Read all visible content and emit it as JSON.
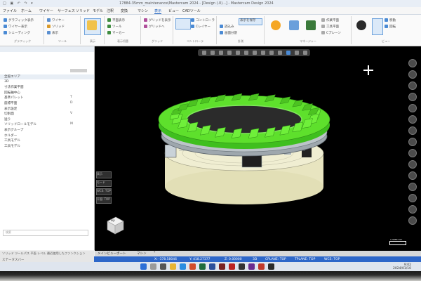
{
  "window": {
    "title": "17884-35mm_maintenance\\Mastercam 2024 - [Design (.0)...] - Mastercam Design 2024",
    "quick_access": "□ ▣ ↶ ↷ ▾"
  },
  "menu_tabs": [
    "ファイル",
    "ホーム",
    "ワイヤー",
    "サーフェス",
    "ソリッド",
    "モデル",
    "注釈",
    "変換",
    "マシン",
    "表示",
    "ビュー",
    "CADツール"
  ],
  "ribbon": {
    "groups": [
      {
        "name": "group-select",
        "label": "グラフィック",
        "items": [
          "グラフィック表示",
          "ワイヤー表示",
          "シェーディング"
        ]
      },
      {
        "name": "group-toolpath",
        "label": "ツール",
        "items": [
          "ワイヤー",
          "ソリッド",
          "表示"
        ]
      },
      {
        "name": "group-display",
        "label": "表示",
        "items": [
          "表示",
          "非表示",
          "全表示"
        ]
      },
      {
        "name": "group-view",
        "label": "表示切替",
        "items": [
          "平面表示",
          "ツール",
          "マーカー"
        ]
      },
      {
        "name": "group-grid",
        "label": "グリッド",
        "items": [
          "グリッドを表示",
          "グリッドへ"
        ]
      },
      {
        "name": "group-controller",
        "label": "コントローラ",
        "items": [
          "コントローラ",
          "Cレイヤー"
        ]
      },
      {
        "name": "group-measure",
        "label": "計測",
        "items": [
          "表示を保存",
          "読込み",
          "画面分割"
        ]
      },
      {
        "name": "group-manager",
        "label": "マネージャー",
        "items": [
          "作業平面",
          "工具平面",
          "Cプレーン"
        ]
      },
      {
        "name": "group-extra",
        "label": "ビュー",
        "items": [
          "移動",
          "回転"
        ]
      }
    ]
  },
  "left_panel": {
    "rows": [
      {
        "label": "全般エリア",
        "value": ""
      },
      {
        "label": "3D",
        "value": ""
      },
      {
        "label": "寸法作業平面",
        "value": ""
      },
      {
        "label": "回転軸中心",
        "value": ""
      },
      {
        "label": "基準パレット",
        "value": "T"
      },
      {
        "label": "座標平面",
        "value": "D"
      },
      {
        "label": "表示設定",
        "value": ""
      },
      {
        "label": "切削面",
        "value": "V"
      },
      {
        "label": "送り",
        ": value": "",
        "value": ""
      },
      {
        "label": "ソリッドロールモデル",
        "value": "M"
      },
      {
        "label": "表示グループ",
        "value": ""
      },
      {
        "label": "ホルダー",
        "value": ""
      },
      {
        "label": "工具モデル",
        "value": ""
      },
      {
        "label": "工具モデル",
        "value": ""
      }
    ],
    "search_placeholder": "検索",
    "bottom_label": "ソリッド ツールパス 平面 レベル 最近使用したファンクション"
  },
  "viewport": {
    "left_tools": [
      "表示",
      "モード",
      "WCS: TOP",
      "平面: TOP"
    ],
    "navcube_face": "Top",
    "scale_label": "1.3956 mm"
  },
  "doc_tabs": [
    "メインビューポート",
    "マシン",
    "*",
    ""
  ],
  "status_bar": {
    "left": "ステータスバー",
    "items": [
      "X: -378.58046",
      "Y: 418.27377",
      "Z: 0.00000",
      "3D",
      "CPLANE: TOP",
      "TPLANE: TOP",
      "WCS: TOP"
    ]
  },
  "taskbar": {
    "time": "9:02",
    "date": "2024/01/10"
  },
  "colors": {
    "viewport_bg": "#000000",
    "status_bar": "#2e67c9",
    "model_green": "#55e02a",
    "model_cream": "#efeccb"
  }
}
